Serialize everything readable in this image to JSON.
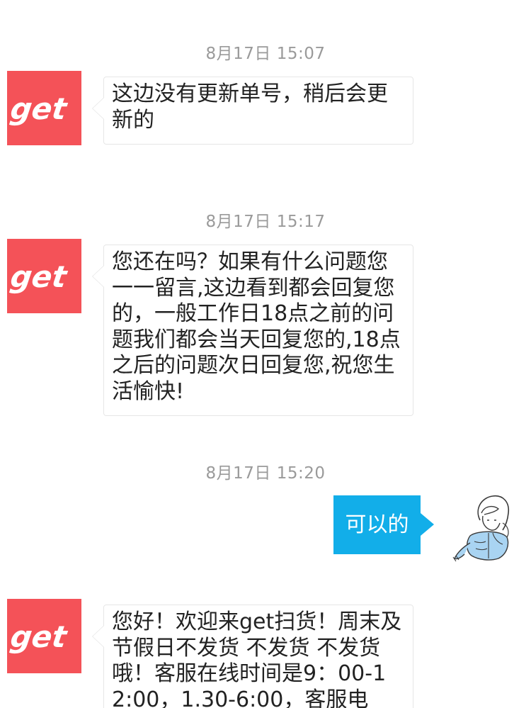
{
  "colors": {
    "brand": "#f45258",
    "outgoing_bubble": "#12aee9",
    "timestamp": "#9a9a9a",
    "text": "#222222"
  },
  "avatar": {
    "logo_text": "get"
  },
  "messages": [
    {
      "timestamp": "8月17日 15:07",
      "text": "这边没有更新单号，稍后会更新的"
    },
    {
      "timestamp": "8月17日 15:17",
      "text": "您还在吗？如果有什么问题您一一留言,这边看到都会回复您的，一般工作日18点之前的问题我们都会当天回复您的,18点之后的问题次日回复您,祝您生活愉快!"
    },
    {
      "timestamp": "8月17日 15:20",
      "text": "可以的"
    },
    {
      "timestamp": "",
      "text": "您好！欢迎来get扫货！周末及节假日不发货 不发货 不发货哦！客服在线时间是9：00-12:00，1.30-6:00，客服电"
    }
  ]
}
